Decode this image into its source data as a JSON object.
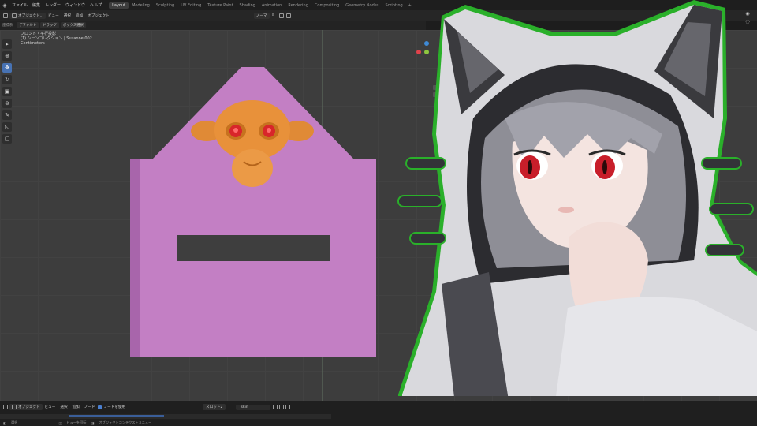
{
  "menu": {
    "logo_glyph": "◈",
    "items": [
      "ファイル",
      "編集",
      "レンダー",
      "ウィンドウ",
      "ヘルプ"
    ],
    "workspaces": [
      "Layout",
      "Modeling",
      "Sculpting",
      "UV Editing",
      "Texture Paint",
      "Shading",
      "Animation",
      "Rendering",
      "Compositing",
      "Geometry Nodes",
      "Scripting"
    ],
    "active_workspace": "Layout",
    "add_tab": "+"
  },
  "toolbar": {
    "mode": "オブジェクト...",
    "view": "ビュー",
    "select": "選択",
    "add": "追加",
    "object": "オブジェクト",
    "transform": "ノーマ",
    "pivot_glyph": "⊙"
  },
  "header": {
    "orientation_label": "座標系",
    "orientation": "デフォルト",
    "drag_label": "ドラッグ",
    "select_box": "ボックス選択"
  },
  "viewport": {
    "view_name": "フロント・平行投影",
    "collection": "(1) シーンコレクション | Suzanne.002",
    "units": "Centimeters"
  },
  "bottom": {
    "mode": "オブジェクト",
    "view": "ビュー",
    "select": "選択",
    "add": "追加",
    "node": "ノード",
    "use_nodes": "ノードを使用",
    "slot": "スロット2",
    "material": "skin",
    "status_select": "選択",
    "status_rotate": "ビューを回転",
    "status_context": "オブジェクトコンテクストメニュー"
  },
  "colors": {
    "mesh_pink": "#c37fc4",
    "monkey_orange": "#e8913a",
    "eye_red": "#d8262a",
    "accent_blue": "#4772b3",
    "outline_green": "#2ab02a"
  }
}
